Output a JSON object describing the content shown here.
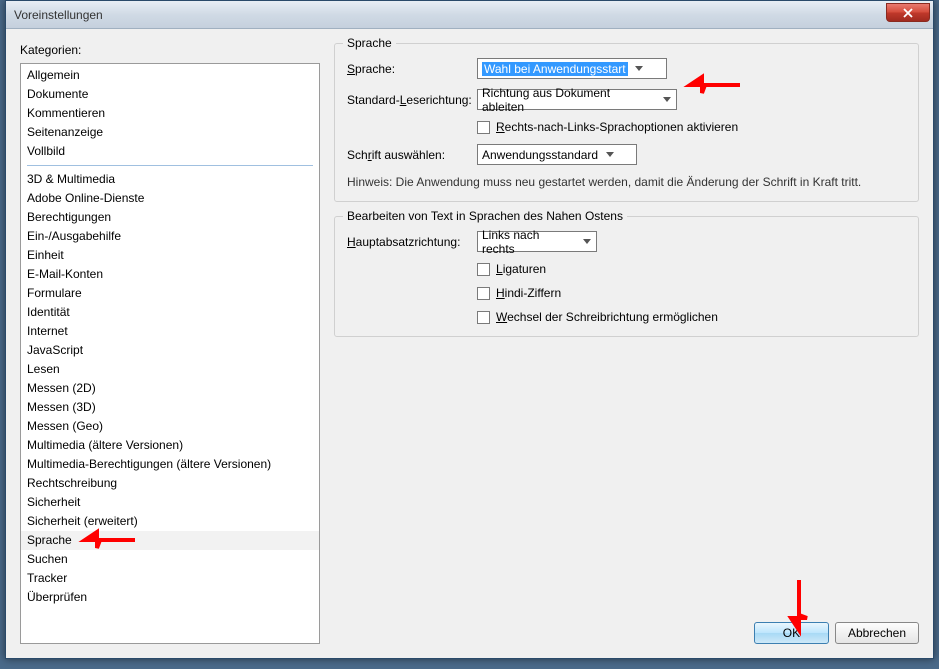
{
  "title": "Voreinstellungen",
  "categories_label": "Kategorien:",
  "categories_top": [
    "Allgemein",
    "Dokumente",
    "Kommentieren",
    "Seitenanzeige",
    "Vollbild"
  ],
  "categories_rest": [
    "3D & Multimedia",
    "Adobe Online-Dienste",
    "Berechtigungen",
    "Ein-/Ausgabehilfe",
    "Einheit",
    "E-Mail-Konten",
    "Formulare",
    "Identität",
    "Internet",
    "JavaScript",
    "Lesen",
    "Messen (2D)",
    "Messen (3D)",
    "Messen (Geo)",
    "Multimedia (ältere Versionen)",
    "Multimedia-Berechtigungen (ältere Versionen)",
    "Rechtschreibung",
    "Sicherheit",
    "Sicherheit (erweitert)",
    "Sprache",
    "Suchen",
    "Tracker",
    "Überprüfen"
  ],
  "selected_category": "Sprache",
  "group_language": {
    "title": "Sprache",
    "lang_label": "Sprache:",
    "lang_value": "Wahl bei Anwendungsstart",
    "dir_label": "Standard-Leserichtung:",
    "dir_value": "Richtung aus Dokument ableiten",
    "rtl_checkbox": "Rechts-nach-Links-Sprachoptionen aktivieren",
    "font_label": "Schrift auswählen:",
    "font_value": "Anwendungsstandard",
    "hint": "Hinweis: Die Anwendung muss neu gestartet werden, damit die Änderung der Schrift in Kraft tritt."
  },
  "group_me": {
    "title": "Bearbeiten von Text in Sprachen des Nahen Ostens",
    "para_label": "Hauptabsatzrichtung:",
    "para_value": "Links nach rechts",
    "ligatures": "Ligaturen",
    "hindi": "Hindi-Ziffern",
    "switch": "Wechsel der Schreibrichtung ermöglichen"
  },
  "buttons": {
    "ok": "OK",
    "cancel": "Abbrechen"
  }
}
